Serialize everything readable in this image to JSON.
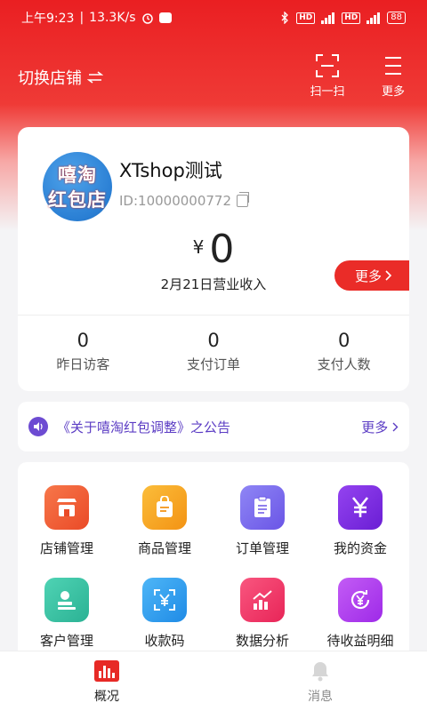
{
  "status_bar": {
    "time": "上午9:23",
    "speed": "13.3K/s",
    "battery": "88"
  },
  "header": {
    "switch_store": "切换店铺",
    "scan_label": "扫一扫",
    "more_label": "更多"
  },
  "store": {
    "logo_line1": "嘻淘",
    "logo_line2": "红包店",
    "name": "XTshop测试",
    "id": "ID:10000000772",
    "currency": "¥",
    "revenue": "0",
    "revenue_label": "2月21日营业收入",
    "more_label": "更多"
  },
  "stats": [
    {
      "value": "0",
      "label": "昨日访客"
    },
    {
      "value": "0",
      "label": "支付订单"
    },
    {
      "value": "0",
      "label": "支付人数"
    }
  ],
  "notice": {
    "text": "《关于嘻淘红包调整》之公告",
    "more_label": "更多"
  },
  "grid": [
    {
      "label": "店铺管理",
      "icon": "store-icon",
      "color": "#ef5a32"
    },
    {
      "label": "商品管理",
      "icon": "shopping-bag-icon",
      "color": "#f5a11d"
    },
    {
      "label": "订单管理",
      "icon": "clipboard-icon",
      "color": "#7b69ee"
    },
    {
      "label": "我的资金",
      "icon": "yen-icon",
      "color": "#7a2ee0"
    },
    {
      "label": "客户管理",
      "icon": "customer-icon",
      "color": "#38c2a3"
    },
    {
      "label": "收款码",
      "icon": "scan-yen-icon",
      "color": "#2e9fee"
    },
    {
      "label": "数据分析",
      "icon": "chart-icon",
      "color": "#f2366a"
    },
    {
      "label": "待收益明细",
      "icon": "yen-refresh-icon",
      "color": "#b13ef0"
    }
  ],
  "tabs": [
    {
      "label": "概况",
      "icon": "bar-chart-icon"
    },
    {
      "label": "消息",
      "icon": "bell-icon"
    }
  ]
}
